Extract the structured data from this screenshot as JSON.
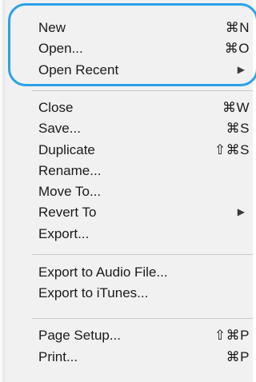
{
  "menu": {
    "groups": [
      {
        "items": [
          {
            "label": "New",
            "shortcut": "⌘N"
          },
          {
            "label": "Open...",
            "shortcut": "⌘O"
          },
          {
            "label": "Open Recent",
            "submenu": "▶"
          }
        ]
      },
      {
        "items": [
          {
            "label": "Close",
            "shortcut": "⌘W"
          },
          {
            "label": "Save...",
            "shortcut": "⌘S"
          },
          {
            "label": "Duplicate",
            "shortcut": "⇧⌘S"
          },
          {
            "label": "Rename..."
          },
          {
            "label": "Move To..."
          },
          {
            "label": "Revert To",
            "submenu": "▶"
          },
          {
            "label": "Export..."
          }
        ]
      },
      {
        "items": [
          {
            "label": "Export to Audio File..."
          },
          {
            "label": "Export to iTunes..."
          }
        ]
      },
      {
        "items": [
          {
            "label": "Page Setup...",
            "shortcut": "⇧⌘P"
          },
          {
            "label": "Print...",
            "shortcut": "⌘P"
          }
        ]
      }
    ]
  },
  "highlight": {
    "color": "#2aa1e8"
  }
}
